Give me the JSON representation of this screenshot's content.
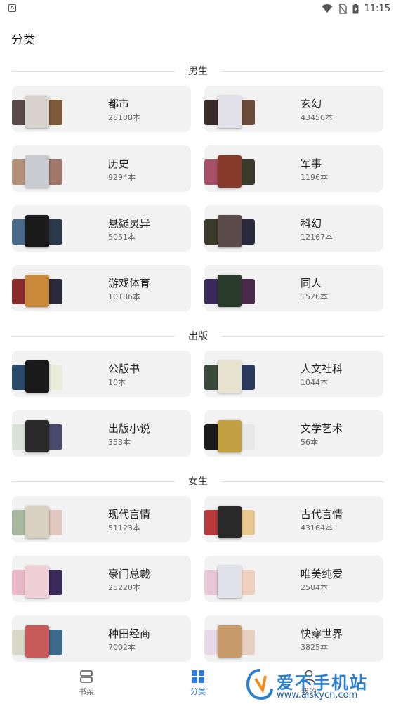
{
  "status_bar": {
    "time": "11:15"
  },
  "page": {
    "title": "分类"
  },
  "sections": [
    {
      "title": "男生",
      "items": [
        {
          "name": "都市",
          "count": "28108本",
          "colors": [
            "#5a4a4a",
            "#d8d2cc",
            "#7c5a3a"
          ]
        },
        {
          "name": "玄幻",
          "count": "43456本",
          "colors": [
            "#3a2a2a",
            "#e2e0e8",
            "#6a4a3a"
          ]
        },
        {
          "name": "历史",
          "count": "9294本",
          "colors": [
            "#b2907a",
            "#c8cbd0",
            "#a0786a"
          ]
        },
        {
          "name": "军事",
          "count": "1196本",
          "colors": [
            "#a8506a",
            "#8a3a2a",
            "#3a3a2a"
          ]
        },
        {
          "name": "悬疑灵异",
          "count": "5051本",
          "colors": [
            "#4a6a8a",
            "#1a1a1a",
            "#2a3a4a"
          ]
        },
        {
          "name": "科幻",
          "count": "12167本",
          "colors": [
            "#3a3a2a",
            "#5a4a4a",
            "#2a2a3a"
          ]
        },
        {
          "name": "游戏体育",
          "count": "10186本",
          "colors": [
            "#8a2a2a",
            "#c88a3a",
            "#2a2a3a"
          ]
        },
        {
          "name": "同人",
          "count": "1526本",
          "colors": [
            "#3a2a5a",
            "#2a3a2a",
            "#4a2a4a"
          ]
        }
      ]
    },
    {
      "title": "出版",
      "items": [
        {
          "name": "公版书",
          "count": "10本",
          "colors": [
            "#2a4a6a",
            "#1a1a1a",
            "#e8ecd8"
          ]
        },
        {
          "name": "人文社科",
          "count": "1044本",
          "colors": [
            "#3a4a3a",
            "#e8e2d0",
            "#2a3a5a"
          ]
        },
        {
          "name": "出版小说",
          "count": "353本",
          "colors": [
            "#d8e2d8",
            "#2a2a2a",
            "#4a4a6a"
          ]
        },
        {
          "name": "文学艺术",
          "count": "56本",
          "colors": [
            "#1a1a1a",
            "#c0a040",
            "#e8e8e8"
          ]
        }
      ]
    },
    {
      "title": "女生",
      "items": [
        {
          "name": "现代言情",
          "count": "51123本",
          "colors": [
            "#a8b8a0",
            "#d8d0c0",
            "#e0c8c0"
          ]
        },
        {
          "name": "古代言情",
          "count": "43164本",
          "colors": [
            "#b83a3a",
            "#2a2a2a",
            "#e8c890"
          ]
        },
        {
          "name": "豪门总裁",
          "count": "25220本",
          "colors": [
            "#e8b8c8",
            "#f0d0d8",
            "#3a2a5a"
          ]
        },
        {
          "name": "唯美纯爱",
          "count": "2584本",
          "colors": [
            "#e8c8d8",
            "#e0e0e8",
            "#f0d0c0"
          ]
        },
        {
          "name": "种田经商",
          "count": "7002本",
          "colors": [
            "#d8d8c8",
            "#c85a5a",
            "#3a6a8a"
          ]
        },
        {
          "name": "快穿世界",
          "count": "3825本",
          "colors": [
            "#e8d8e8",
            "#c89a6a",
            "#e8d0c0"
          ]
        }
      ]
    }
  ],
  "bottom_nav": [
    {
      "label": "书架",
      "icon": "bookshelf-icon",
      "active": false
    },
    {
      "label": "分类",
      "icon": "category-grid-icon",
      "active": true
    },
    {
      "label": "我的",
      "icon": "profile-icon",
      "active": false
    }
  ],
  "watermark": {
    "text": "爱不手机站",
    "url": "www.aiskycn.com"
  },
  "colors": {
    "accent": "#2d7be6",
    "card_bg": "#f2f2f2"
  }
}
